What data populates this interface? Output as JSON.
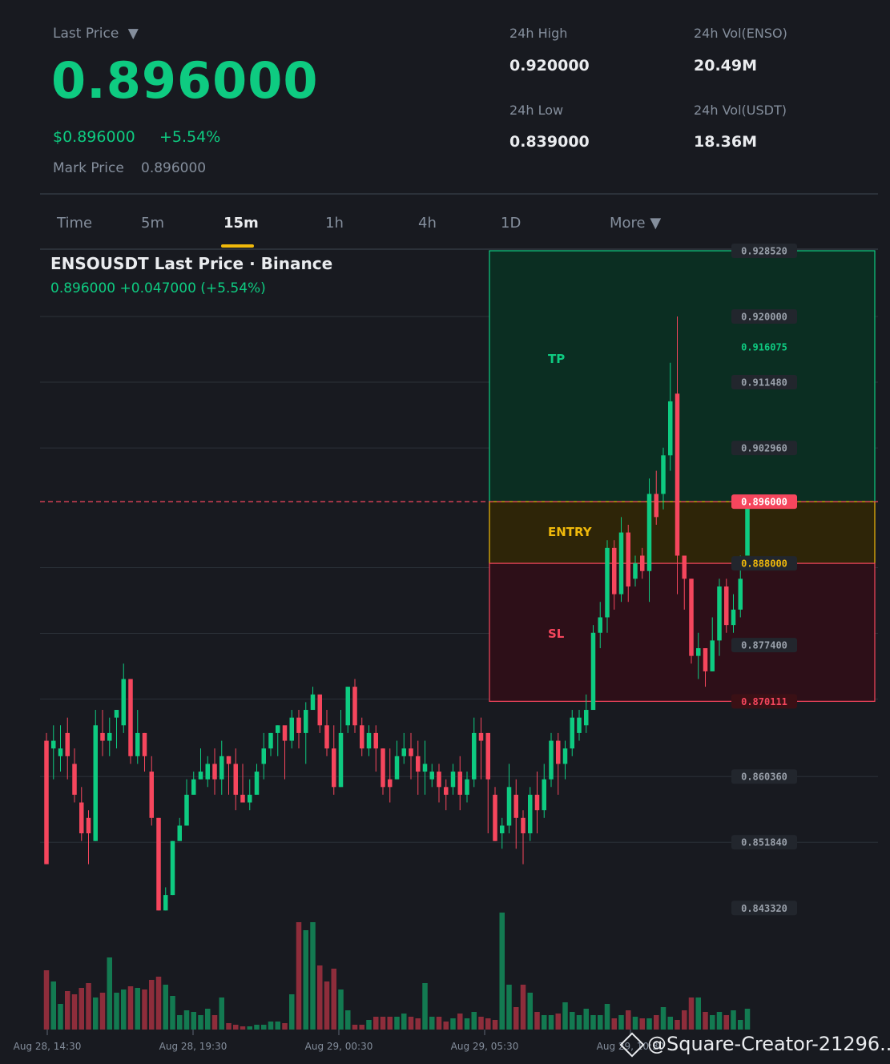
{
  "header": {
    "last_price_label": "Last Price",
    "last_price_dropdown": "▼",
    "price": "0.896000",
    "usd_price": "$0.896000",
    "change_pct": "+5.54%",
    "mark_price_label": "Mark Price",
    "mark_price": "0.896000"
  },
  "stats": {
    "high_label": "24h High",
    "high": "0.920000",
    "low_label": "24h Low",
    "low": "0.839000",
    "vol_base_label": "24h Vol(ENSO)",
    "vol_base": "20.49M",
    "vol_quote_label": "24h Vol(USDT)",
    "vol_quote": "18.36M"
  },
  "timeframes": [
    "Time",
    "5m",
    "15m",
    "1h",
    "4h",
    "1D",
    "More ▼"
  ],
  "active_timeframe": "15m",
  "chart_header": {
    "title": "ENSOUSDT Last Price · Binance",
    "subtitle": "0.896000  +0.047000 (+5.54%)"
  },
  "zones": {
    "tp_label": "TP",
    "entry_label": "ENTRY",
    "sl_label": "SL",
    "tp_top": 0.92852,
    "entry": 0.896,
    "entry_low": 0.888,
    "sl": 0.870111,
    "tp_price_tag": "0.916075"
  },
  "colors": {
    "up": "#0ecb81",
    "down": "#f6465d",
    "entry": "#f0b90b",
    "bg": "#181a20",
    "tp_zone": "#0b2e22",
    "entry_zone": "#2e2508",
    "sl_zone": "#2d0f18"
  },
  "price_axis_labels": [
    "0.928520",
    "0.920000",
    "0.911480",
    "0.902960",
    "0.896000",
    "0.888000",
    "0.877400",
    "0.870111",
    "0.860360",
    "0.851840",
    "0.843320"
  ],
  "chart_data": {
    "type": "candlestick",
    "title": "ENSOUSDT Last Price · Binance",
    "ylim": [
      0.84314,
      0.92852
    ],
    "x_tick_labels": [
      "Aug 28, 14:30",
      "Aug 28, 19:30",
      "Aug 29, 00:30",
      "Aug 29, 05:30",
      "Aug 29, 10:30"
    ],
    "candles": [
      [
        0.865,
        0.849,
        0.849,
        0.866
      ],
      [
        0.864,
        0.865,
        0.86,
        0.867
      ],
      [
        0.863,
        0.864,
        0.861,
        0.867
      ],
      [
        0.866,
        0.863,
        0.86,
        0.868
      ],
      [
        0.862,
        0.858,
        0.857,
        0.864
      ],
      [
        0.857,
        0.853,
        0.852,
        0.859
      ],
      [
        0.855,
        0.853,
        0.849,
        0.856
      ],
      [
        0.852,
        0.867,
        0.852,
        0.869
      ],
      [
        0.866,
        0.865,
        0.863,
        0.869
      ],
      [
        0.865,
        0.866,
        0.863,
        0.868
      ],
      [
        0.868,
        0.869,
        0.864,
        0.869
      ],
      [
        0.867,
        0.873,
        0.866,
        0.875
      ],
      [
        0.873,
        0.863,
        0.862,
        0.873
      ],
      [
        0.863,
        0.866,
        0.862,
        0.869
      ],
      [
        0.866,
        0.863,
        0.861,
        0.866
      ],
      [
        0.861,
        0.855,
        0.854,
        0.863
      ],
      [
        0.855,
        0.843,
        0.843,
        0.855
      ],
      [
        0.843,
        0.845,
        0.843,
        0.846
      ],
      [
        0.845,
        0.852,
        0.845,
        0.852
      ],
      [
        0.852,
        0.854,
        0.852,
        0.855
      ],
      [
        0.854,
        0.858,
        0.854,
        0.86
      ],
      [
        0.858,
        0.86,
        0.858,
        0.861
      ],
      [
        0.86,
        0.861,
        0.86,
        0.864
      ],
      [
        0.86,
        0.862,
        0.859,
        0.863
      ],
      [
        0.862,
        0.86,
        0.858,
        0.864
      ],
      [
        0.86,
        0.863,
        0.858,
        0.865
      ],
      [
        0.863,
        0.862,
        0.858,
        0.863
      ],
      [
        0.862,
        0.858,
        0.856,
        0.864
      ],
      [
        0.858,
        0.857,
        0.857,
        0.862
      ],
      [
        0.857,
        0.858,
        0.856,
        0.86
      ],
      [
        0.858,
        0.861,
        0.858,
        0.862
      ],
      [
        0.862,
        0.864,
        0.86,
        0.866
      ],
      [
        0.864,
        0.866,
        0.863,
        0.866
      ],
      [
        0.866,
        0.867,
        0.863,
        0.867
      ],
      [
        0.867,
        0.865,
        0.86,
        0.866
      ],
      [
        0.865,
        0.868,
        0.864,
        0.869
      ],
      [
        0.868,
        0.866,
        0.864,
        0.869
      ],
      [
        0.866,
        0.869,
        0.862,
        0.87
      ],
      [
        0.869,
        0.871,
        0.869,
        0.872
      ],
      [
        0.871,
        0.867,
        0.866,
        0.871
      ],
      [
        0.867,
        0.864,
        0.863,
        0.869
      ],
      [
        0.864,
        0.859,
        0.858,
        0.867
      ],
      [
        0.859,
        0.866,
        0.859,
        0.869
      ],
      [
        0.867,
        0.872,
        0.866,
        0.872
      ],
      [
        0.872,
        0.867,
        0.866,
        0.873
      ],
      [
        0.867,
        0.864,
        0.863,
        0.868
      ],
      [
        0.864,
        0.866,
        0.863,
        0.867
      ],
      [
        0.866,
        0.864,
        0.861,
        0.867
      ],
      [
        0.864,
        0.859,
        0.858,
        0.864
      ],
      [
        0.86,
        0.859,
        0.857,
        0.864
      ],
      [
        0.86,
        0.863,
        0.86,
        0.865
      ],
      [
        0.863,
        0.864,
        0.862,
        0.866
      ],
      [
        0.864,
        0.863,
        0.86,
        0.866
      ],
      [
        0.863,
        0.861,
        0.858,
        0.865
      ],
      [
        0.861,
        0.862,
        0.858,
        0.865
      ],
      [
        0.86,
        0.861,
        0.859,
        0.862
      ],
      [
        0.861,
        0.859,
        0.857,
        0.862
      ],
      [
        0.859,
        0.858,
        0.856,
        0.86
      ],
      [
        0.859,
        0.861,
        0.858,
        0.862
      ],
      [
        0.861,
        0.858,
        0.856,
        0.863
      ],
      [
        0.858,
        0.86,
        0.857,
        0.861
      ],
      [
        0.86,
        0.866,
        0.859,
        0.868
      ],
      [
        0.866,
        0.865,
        0.86,
        0.868
      ],
      [
        0.866,
        0.86,
        0.853,
        0.866
      ],
      [
        0.858,
        0.852,
        0.852,
        0.859
      ],
      [
        0.853,
        0.854,
        0.851,
        0.855
      ],
      [
        0.854,
        0.859,
        0.853,
        0.862
      ],
      [
        0.858,
        0.855,
        0.851,
        0.86
      ],
      [
        0.855,
        0.853,
        0.849,
        0.856
      ],
      [
        0.853,
        0.858,
        0.852,
        0.859
      ],
      [
        0.858,
        0.856,
        0.853,
        0.861
      ],
      [
        0.856,
        0.86,
        0.855,
        0.862
      ],
      [
        0.86,
        0.865,
        0.859,
        0.866
      ],
      [
        0.865,
        0.862,
        0.858,
        0.866
      ],
      [
        0.862,
        0.864,
        0.86,
        0.865
      ],
      [
        0.864,
        0.868,
        0.863,
        0.869
      ],
      [
        0.866,
        0.868,
        0.865,
        0.869
      ],
      [
        0.867,
        0.869,
        0.866,
        0.871
      ],
      [
        0.869,
        0.879,
        0.869,
        0.88
      ],
      [
        0.879,
        0.881,
        0.877,
        0.883
      ],
      [
        0.881,
        0.89,
        0.879,
        0.891
      ],
      [
        0.89,
        0.884,
        0.882,
        0.891
      ],
      [
        0.884,
        0.892,
        0.883,
        0.894
      ],
      [
        0.892,
        0.885,
        0.883,
        0.893
      ],
      [
        0.886,
        0.888,
        0.885,
        0.889
      ],
      [
        0.889,
        0.887,
        0.886,
        0.89
      ],
      [
        0.887,
        0.897,
        0.883,
        0.899
      ],
      [
        0.897,
        0.894,
        0.893,
        0.9
      ],
      [
        0.897,
        0.902,
        0.895,
        0.903
      ],
      [
        0.902,
        0.909,
        0.9,
        0.914
      ],
      [
        0.91,
        0.889,
        0.884,
        0.92
      ],
      [
        0.889,
        0.886,
        0.882,
        0.889
      ],
      [
        0.886,
        0.876,
        0.875,
        0.886
      ],
      [
        0.876,
        0.877,
        0.873,
        0.879
      ],
      [
        0.877,
        0.874,
        0.872,
        0.877
      ],
      [
        0.874,
        0.878,
        0.874,
        0.881
      ],
      [
        0.878,
        0.885,
        0.876,
        0.886
      ],
      [
        0.885,
        0.88,
        0.879,
        0.886
      ],
      [
        0.88,
        0.882,
        0.879,
        0.884
      ],
      [
        0.882,
        0.886,
        0.881,
        0.889
      ],
      [
        0.889,
        0.896,
        0.889,
        0.896
      ]
    ],
    "volume": [
      37,
      30,
      16,
      24,
      22,
      26,
      29,
      20,
      23,
      45,
      23,
      25,
      27,
      26,
      25,
      31,
      33,
      28,
      21,
      9,
      12,
      11,
      9,
      13,
      9,
      20,
      4,
      3,
      2,
      2,
      3,
      3,
      5,
      5,
      4,
      22,
      67,
      62,
      67,
      40,
      30,
      38,
      25,
      12,
      3,
      3,
      6,
      8,
      8,
      8,
      8,
      10,
      8,
      7,
      29,
      8,
      8,
      5,
      7,
      10,
      7,
      11,
      8,
      7,
      6,
      73,
      28,
      14,
      28,
      23,
      11,
      9,
      9,
      10,
      17,
      11,
      9,
      13,
      9,
      9,
      16,
      7,
      9,
      12,
      8,
      7,
      7,
      9,
      14,
      8,
      6,
      12,
      20,
      20,
      11,
      9,
      11,
      9,
      12,
      6,
      13
    ]
  },
  "watermark": "@Square-Creator-21296..."
}
